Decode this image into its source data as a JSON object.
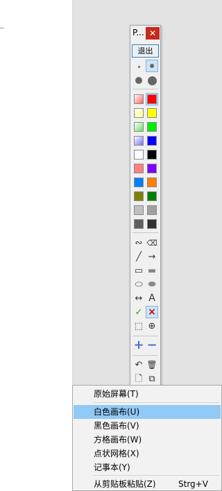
{
  "palette": {
    "title": "P...",
    "close": "✕",
    "exit_label": "退出",
    "colors": [
      {
        "a": "#ff6060",
        "b": "#ff0000",
        "a_grad": true
      },
      {
        "a": "#ffff80",
        "b": "#ffff00",
        "a_grad": true
      },
      {
        "a": "#60e060",
        "b": "#00ee00",
        "a_grad": true
      },
      {
        "a": "#7070ff",
        "b": "#0000ff",
        "a_grad": true
      },
      {
        "a": "#ffffff",
        "b": "#000000"
      },
      {
        "a": "#ff8080",
        "b": "#8000ff"
      },
      {
        "a": "#0080ff",
        "b": "#ff8000"
      },
      {
        "a": "#808000",
        "b": "#008000"
      },
      {
        "a": "#c0c0c0",
        "b": "#a0a0a0"
      },
      {
        "a": "#606060",
        "b": "#303030"
      }
    ],
    "tool_icons": {
      "freehand": "∾",
      "eraser": "⌫",
      "line": "╱",
      "arrow": "→",
      "rect": "▭",
      "filled_rect": "▬",
      "ellipse": "⬭",
      "filled_ellipse": "⬬",
      "double_arrow": "↔",
      "text": "A",
      "confirm": "✓",
      "cancel": "×",
      "select": "⬚",
      "zoom": "⊕",
      "plus": "+",
      "minus": "−",
      "undo": "↶",
      "trash": "🗑",
      "new_page": "🗋",
      "copy": "⧉"
    },
    "accent_green": "#1aa01a",
    "accent_red": "#cc0000"
  },
  "menu": {
    "items": [
      {
        "label": "原始屏幕(T)",
        "shortcut": ""
      },
      {
        "label": "白色画布(U)",
        "shortcut": ""
      },
      {
        "label": "黑色画布(V)",
        "shortcut": ""
      },
      {
        "label": "方格画布(W)",
        "shortcut": ""
      },
      {
        "label": "点状网格(X)",
        "shortcut": ""
      },
      {
        "label": "记事本(Y)",
        "shortcut": ""
      },
      {
        "label": "从剪贴板粘贴(Z)",
        "shortcut": "Strg+V"
      }
    ],
    "highlight_color": "#91c9f7"
  }
}
